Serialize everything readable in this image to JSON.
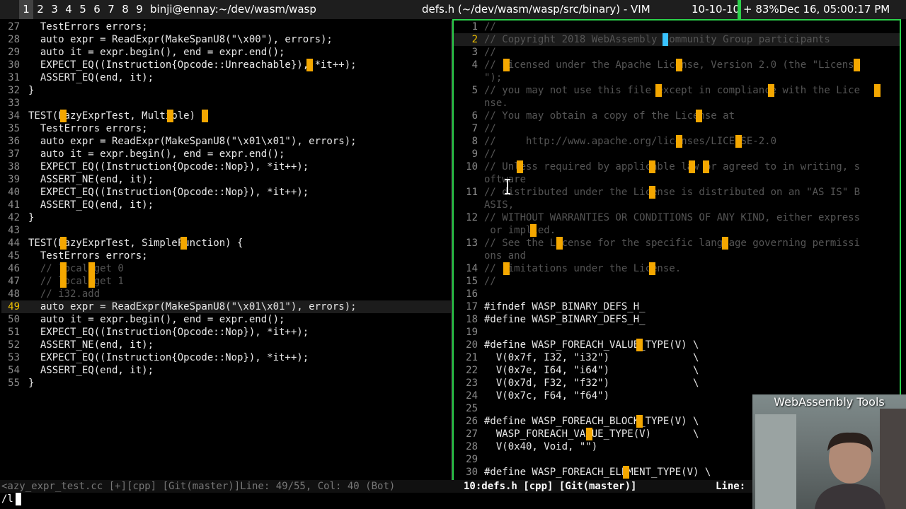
{
  "topbar": {
    "workspaces": [
      "1",
      "2",
      "3",
      "4",
      "5",
      "6",
      "7",
      "8",
      "9"
    ],
    "active_workspace": "1",
    "left_window_title": "binji@ennay:~/dev/wasm/wasp",
    "right_window_title": "defs.h (~/dev/wasm/wasp/src/binary) - VIM",
    "date_short": "10-10-10",
    "status": "+ 83%Dec 16, 05:00:17 PM"
  },
  "left_pane": {
    "lines": [
      {
        "num": "27",
        "text": "  TestErrors errors;"
      },
      {
        "num": "28",
        "text": "  auto expr = ReadExpr(MakeSpanU8(\"\\x00\"), errors);"
      },
      {
        "num": "29",
        "text": "  auto it = expr.begin(), end = expr.end();"
      },
      {
        "num": "30",
        "text": "  EXPECT_EQ((Instruction{Opcode::Unreachable}), *it++);"
      },
      {
        "num": "31",
        "text": "  ASSERT_EQ(end, it);"
      },
      {
        "num": "32",
        "text": "}"
      },
      {
        "num": "33",
        "text": ""
      },
      {
        "num": "34",
        "text": "TEST(LazyExprTest, Multiple) {"
      },
      {
        "num": "35",
        "text": "  TestErrors errors;"
      },
      {
        "num": "36",
        "text": "  auto expr = ReadExpr(MakeSpanU8(\"\\x01\\x01\"), errors);"
      },
      {
        "num": "37",
        "text": "  auto it = expr.begin(), end = expr.end();"
      },
      {
        "num": "38",
        "text": "  EXPECT_EQ((Instruction{Opcode::Nop}), *it++);"
      },
      {
        "num": "39",
        "text": "  ASSERT_NE(end, it);"
      },
      {
        "num": "40",
        "text": "  EXPECT_EQ((Instruction{Opcode::Nop}), *it++);"
      },
      {
        "num": "41",
        "text": "  ASSERT_EQ(end, it);"
      },
      {
        "num": "42",
        "text": "}"
      },
      {
        "num": "43",
        "text": ""
      },
      {
        "num": "44",
        "text": "TEST(LazyExprTest, SimpleFunction) {"
      },
      {
        "num": "45",
        "text": "  TestErrors errors;"
      },
      {
        "num": "46",
        "text": "  // local.get 0"
      },
      {
        "num": "47",
        "text": "  // local.get 1"
      },
      {
        "num": "48",
        "text": "  // i32.add"
      },
      {
        "num": "49",
        "text": "  auto expr = ReadExpr(MakeSpanU8(\"\\x01\\x01\"), errors);"
      },
      {
        "num": "50",
        "text": "  auto it = expr.begin(), end = expr.end();"
      },
      {
        "num": "51",
        "text": "  EXPECT_EQ((Instruction{Opcode::Nop}), *it++);"
      },
      {
        "num": "52",
        "text": "  ASSERT_NE(end, it);"
      },
      {
        "num": "53",
        "text": "  EXPECT_EQ((Instruction{Opcode::Nop}), *it++);"
      },
      {
        "num": "54",
        "text": "  ASSERT_EQ(end, it);"
      },
      {
        "num": "55",
        "text": "}"
      }
    ],
    "status": "<azy_expr_test.cc [+][cpp] [Git(master)]Line: 49/55, Col: 40 (Bot)"
  },
  "right_pane": {
    "rows": [
      {
        "num": "1",
        "text": "//"
      },
      {
        "num": "2",
        "text": "// Copyright 2018 WebAssembly Community Group participants"
      },
      {
        "num": "3",
        "text": "//"
      },
      {
        "num": "4",
        "text": "// Licensed under the Apache License, Version 2.0 (the \"License"
      },
      {
        "num": "",
        "text": "\");"
      },
      {
        "num": "5",
        "text": "// you may not use this file except in compliance with the Lice"
      },
      {
        "num": "",
        "text": "nse."
      },
      {
        "num": "6",
        "text": "// You may obtain a copy of the License at"
      },
      {
        "num": "7",
        "text": "//"
      },
      {
        "num": "8",
        "text": "//     http://www.apache.org/licenses/LICENSE-2.0"
      },
      {
        "num": "9",
        "text": "//"
      },
      {
        "num": "10",
        "text": "// Unless required by applicable law or agreed to in writing, s"
      },
      {
        "num": "",
        "text": "oftware"
      },
      {
        "num": "11",
        "text": "// distributed under the License is distributed on an \"AS IS\" B"
      },
      {
        "num": "",
        "text": "ASIS,"
      },
      {
        "num": "12",
        "text": "// WITHOUT WARRANTIES OR CONDITIONS OF ANY KIND, either express"
      },
      {
        "num": "",
        "text": " or implied."
      },
      {
        "num": "13",
        "text": "// See the License for the specific language governing permissi"
      },
      {
        "num": "",
        "text": "ons and"
      },
      {
        "num": "14",
        "text": "// limitations under the License."
      },
      {
        "num": "15",
        "text": "//"
      },
      {
        "num": "16",
        "text": ""
      },
      {
        "num": "17",
        "text": "#ifndef WASP_BINARY_DEFS_H_"
      },
      {
        "num": "18",
        "text": "#define WASP_BINARY_DEFS_H_"
      },
      {
        "num": "19",
        "text": ""
      },
      {
        "num": "20",
        "text": "#define WASP_FOREACH_VALUE_TYPE(V) \\"
      },
      {
        "num": "21",
        "text": "  V(0x7f, I32, \"i32\")              \\"
      },
      {
        "num": "22",
        "text": "  V(0x7e, I64, \"i64\")              \\"
      },
      {
        "num": "23",
        "text": "  V(0x7d, F32, \"f32\")              \\"
      },
      {
        "num": "24",
        "text": "  V(0x7c, F64, \"f64\")"
      },
      {
        "num": "25",
        "text": ""
      },
      {
        "num": "26",
        "text": "#define WASP_FOREACH_BLOCK_TYPE(V) \\"
      },
      {
        "num": "27",
        "text": "  WASP_FOREACH_VALUE_TYPE(V)       \\"
      },
      {
        "num": "28",
        "text": "  V(0x40, Void, \"\")"
      },
      {
        "num": "29",
        "text": ""
      },
      {
        "num": "30",
        "text": "#define WASP_FOREACH_ELEMENT_TYPE(V) \\"
      }
    ],
    "status": "10:defs.h [cpp] [Git(master)]",
    "status_line_label": "Line:"
  },
  "cmdline": "/l",
  "webcam": {
    "title": "WebAssembly Tools"
  },
  "colors": {
    "accent_green": "#2bd04a",
    "search_highlight": "#f4a700",
    "cursor_cyan": "#39c3ff",
    "current_line_number": "#f0c000"
  }
}
